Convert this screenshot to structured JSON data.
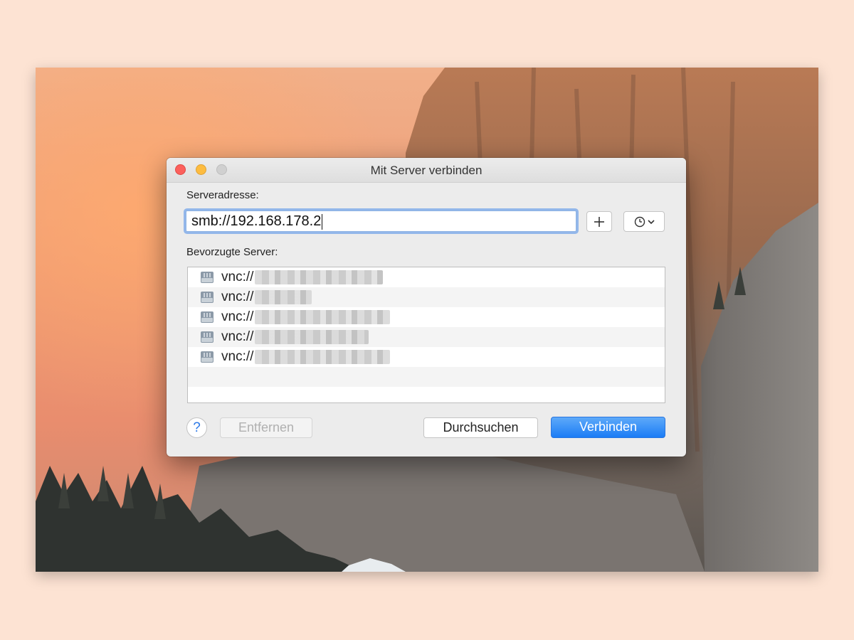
{
  "window": {
    "title": "Mit Server verbinden"
  },
  "address": {
    "label": "Serveradresse:",
    "value": "smb://192.168.178.2"
  },
  "favorites": {
    "label": "Bevorzugte Server:",
    "items": [
      {
        "prefix": "vnc://"
      },
      {
        "prefix": "vnc://"
      },
      {
        "prefix": "vnc://"
      },
      {
        "prefix": "vnc://"
      },
      {
        "prefix": "vnc://"
      }
    ]
  },
  "buttons": {
    "help": "?",
    "remove": "Entfernen",
    "browse": "Durchsuchen",
    "connect": "Verbinden"
  },
  "icons": {
    "close": "close-icon",
    "minimize": "minimize-icon",
    "zoom": "zoom-icon",
    "add": "plus-icon",
    "recent": "clock-icon",
    "server": "network-drive-icon"
  },
  "colors": {
    "accent": "#1b7cf5",
    "close": "#fc605c",
    "minimize": "#fdbc40"
  }
}
